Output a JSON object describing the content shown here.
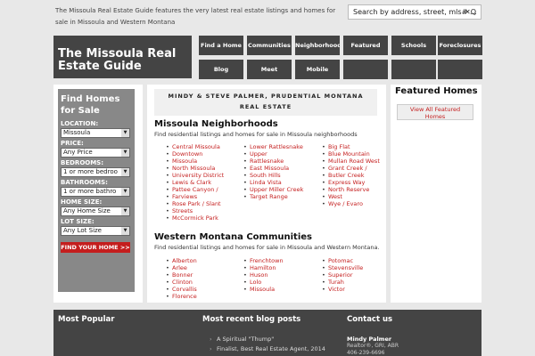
{
  "header": {
    "tagline": "The Missoula Real Estate Guide features the very latest real estate listings and homes for sale in Missoula and Western Montana",
    "search_placeholder": "Search by address, street, mls# …",
    "search_icon": "search-icon"
  },
  "logo": {
    "text": "The Missoula Real Estate Guide"
  },
  "nav": {
    "row1": [
      "Find a Home",
      "Communities",
      "Neighborhoods",
      "Featured",
      "Schools",
      "Foreclosures"
    ],
    "row2": [
      "Blog",
      "Meet",
      "Mobile",
      "",
      "",
      ""
    ]
  },
  "finder": {
    "title": "Find Homes for Sale",
    "location_label": "LOCATION:",
    "location_value": "Missoula",
    "price_label": "PRICE:",
    "price_value": "Any Price",
    "bedrooms_label": "BEDROOMS:",
    "bedrooms_value": "1 or more bedroo",
    "bathrooms_label": "BATHROOMS:",
    "bathrooms_value": "1 or more bathro",
    "homesize_label": "HOME SIZE:",
    "homesize_value": "Any Home Size",
    "lotsize_label": "LOT SIZE:",
    "lotsize_value": "Any Lot Size",
    "button": "FIND YOUR HOME >>"
  },
  "main": {
    "agent_line1": "MINDY & STEVE PALMER, PRUDENTIAL MONTANA",
    "agent_line2": "REAL ESTATE",
    "neighborhoods": {
      "title": "Missoula Neighborhoods",
      "desc": "Find residential listings and homes for sale in Missoula neighborhoods",
      "col1": [
        "Central Missoula",
        "Downtown",
        "Missoula",
        "North Missoula",
        "University District",
        "Lewis & Clark",
        "Pattee Canyon /",
        "Farviews",
        "Rose Park / Slant",
        "Streets",
        "McCormick Park"
      ],
      "col2": [
        "Lower Rattlesnake",
        "Upper",
        "Rattlesnake",
        "East Missoula",
        "South Hills",
        "Linda Vista",
        "Upper Miller Creek",
        "Target Range"
      ],
      "col3": [
        "Big Flat",
        "Blue Mountain",
        "Mullan Road West",
        "Grant Creek /",
        "Butler Creek",
        "Express Way",
        "North Reserve",
        "West",
        "Wye / Evaro"
      ]
    },
    "communities": {
      "title": "Western Montana Communities",
      "desc": "Find residential listings and homes for sale in Missoula and Western Montana.",
      "col1": [
        "Alberton",
        "Arlee",
        "Bonner",
        "Clinton",
        "Corvallis",
        "Florence"
      ],
      "col2": [
        "Frenchtown",
        "Hamilton",
        "Huson",
        "Lolo",
        "Missoula"
      ],
      "col3": [
        "Potomac",
        "Stevensville",
        "Superior",
        "Turah",
        "Victor"
      ]
    }
  },
  "featured": {
    "title": "Featured Homes",
    "button_line1": "View All Featured",
    "button_line2": "Homes"
  },
  "footer": {
    "popular_title": "Most Popular",
    "blog_title": "Most recent blog posts",
    "blog_posts": [
      "A Spiritual \"Thump\"",
      "Finalist, Best Real Estate Agent, 2014"
    ],
    "contact_title": "Contact us",
    "contact_name": "Mindy Palmer",
    "contact_role": "Realtor®, GRI, ABR",
    "contact_phone": "406-239-6696"
  }
}
